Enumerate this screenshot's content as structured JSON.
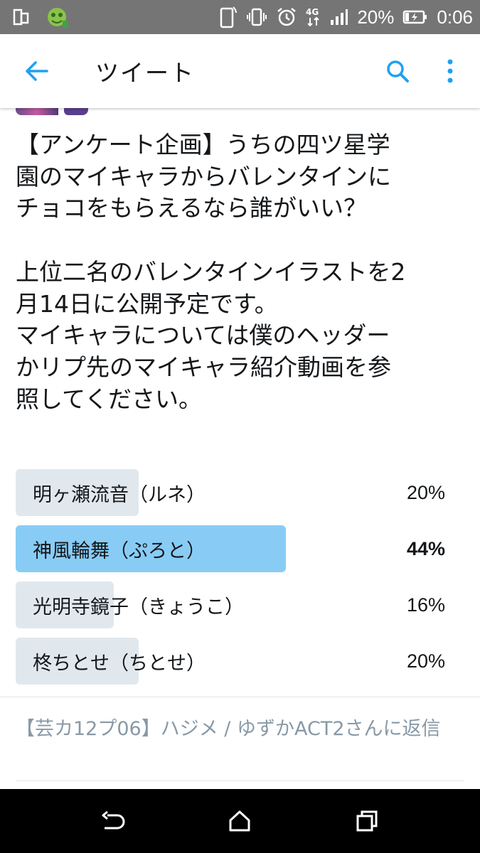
{
  "status_bar": {
    "network": "4G",
    "battery": "20%",
    "time": "0:06",
    "icons": [
      "multiwindow-icon",
      "android-app-icon",
      "notification-phone-icon",
      "vibrate-icon",
      "alarm-icon",
      "network-4g-icon",
      "signal-icon",
      "battery-charging-icon"
    ]
  },
  "app_bar": {
    "title": "ツイート",
    "icons": [
      "back-arrow-icon",
      "search-icon",
      "more-vert-icon"
    ]
  },
  "tweet": {
    "lines": [
      "【アンケート企画】うちの四ツ星学",
      "園のマイキャラからバレンタインに",
      "チョコをもらえるなら誰がいい？",
      "",
      "上位二名のバレンタインイラストを2",
      "月14日に公開予定です。",
      "マイキャラについては僕のヘッダー",
      "かリプ先のマイキャラ紹介動画を参",
      "照してください。"
    ]
  },
  "poll": {
    "accent_color": "#88ccf5",
    "bar_color": "#e1e8ed",
    "options": [
      {
        "label": "明ヶ瀬流音（ルネ）",
        "percent": 20,
        "percent_label": "20%",
        "winner": false
      },
      {
        "label": "神風輪舞（ぷろと）",
        "percent": 44,
        "percent_label": "44%",
        "winner": true
      },
      {
        "label": "光明寺鏡子（きょうこ）",
        "percent": 16,
        "percent_label": "16%",
        "winner": false
      },
      {
        "label": "柊ちとせ（ちとせ）",
        "percent": 20,
        "percent_label": "20%",
        "winner": false
      }
    ]
  },
  "reply_context": {
    "text": "【芸カ12プ06】ハジメ / ゆずかACT2さんに返信"
  },
  "nav_bar": {
    "icons": [
      "back-nav-icon",
      "home-nav-icon",
      "recents-nav-icon"
    ]
  }
}
